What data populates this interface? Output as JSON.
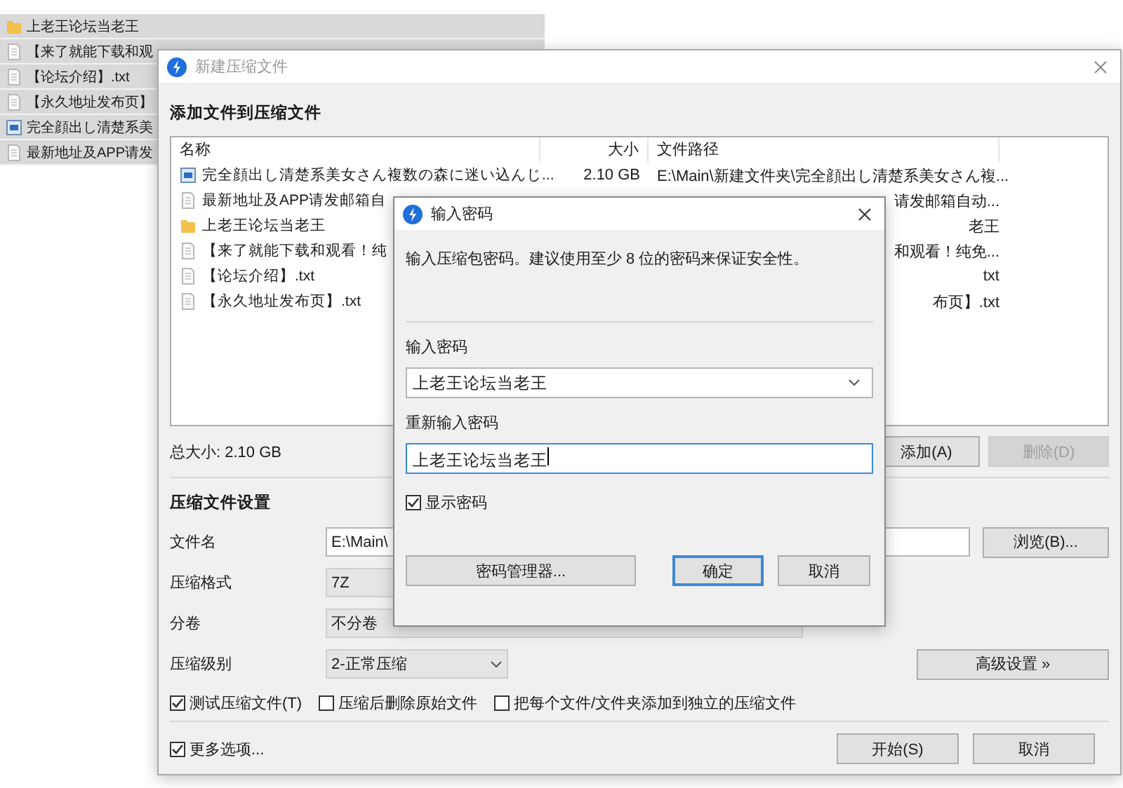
{
  "explorer": {
    "items": [
      {
        "kind": "folder",
        "name": "上老王论坛当老王"
      },
      {
        "kind": "text",
        "name": "【来了就能下载和观"
      },
      {
        "kind": "text",
        "name": "【论坛介绍】.txt"
      },
      {
        "kind": "text",
        "name": "【永久地址发布页】"
      },
      {
        "kind": "video",
        "name": "完全顔出し清楚系美"
      },
      {
        "kind": "text",
        "name": "最新地址及APP请发"
      }
    ]
  },
  "compress_dialog": {
    "title": "新建压缩文件",
    "heading": "添加文件到压缩文件",
    "columns": [
      "名称",
      "大小",
      "文件路径"
    ],
    "files": [
      {
        "kind": "video",
        "name": "完全顔出し清楚系美女さん複数の森に迷い込んじ...",
        "size": "2.10 GB",
        "path": "E:\\Main\\新建文件夹\\完全顔出し清楚系美女さん複..."
      },
      {
        "kind": "text",
        "name": "最新地址及APP请发邮箱自",
        "path": "请发邮箱自动..."
      },
      {
        "kind": "folder",
        "name": "上老王论坛当老王",
        "path": "老王"
      },
      {
        "kind": "text",
        "name": "【来了就能下载和观看！纯",
        "path": "和观看！纯免..."
      },
      {
        "kind": "text",
        "name": "【论坛介绍】.txt",
        "path": "txt"
      },
      {
        "kind": "text",
        "name": "【永久地址发布页】.txt",
        "path": "布页】.txt"
      }
    ],
    "total_size": "总大小: 2.10 GB",
    "add_button": "添加(A)",
    "delete_button": {
      "label": "删除(D)",
      "disabled": true
    },
    "settings_heading": "压缩文件设置",
    "fields": [
      {
        "kind": "text",
        "label": "文件名",
        "value": "E:\\Main\\"
      },
      {
        "kind": "box",
        "label": "压缩格式",
        "value": "7Z"
      },
      {
        "kind": "box",
        "label": "分卷",
        "value": "不分卷"
      },
      {
        "kind": "select",
        "label": "压缩级别",
        "value": "2-正常压缩"
      }
    ],
    "browse_button": "浏览(B)...",
    "advanced_button": "高级设置 »",
    "options": [
      {
        "label": "测试压缩文件(T)",
        "checked": true
      },
      {
        "label": "压缩后删除原始文件",
        "checked": false
      },
      {
        "label": "把每个文件/文件夹添加到独立的压缩文件",
        "checked": false
      }
    ],
    "more_options": {
      "label": "更多选项...",
      "checked": true
    },
    "start_button": "开始(S)",
    "cancel_button": "取消"
  },
  "password_dialog": {
    "title": "输入密码",
    "message": "输入压缩包密码。建议使用至少 8 位的密码来保证安全性。",
    "password_label": "输入密码",
    "password_value": "上老王论坛当老王",
    "confirm_label": "重新输入密码",
    "confirm_value": "上老王论坛当老王",
    "show_password": {
      "label": "显示密码",
      "checked": true
    },
    "manager_button": "密码管理器...",
    "ok_button": "确定",
    "cancel_button": "取消"
  }
}
